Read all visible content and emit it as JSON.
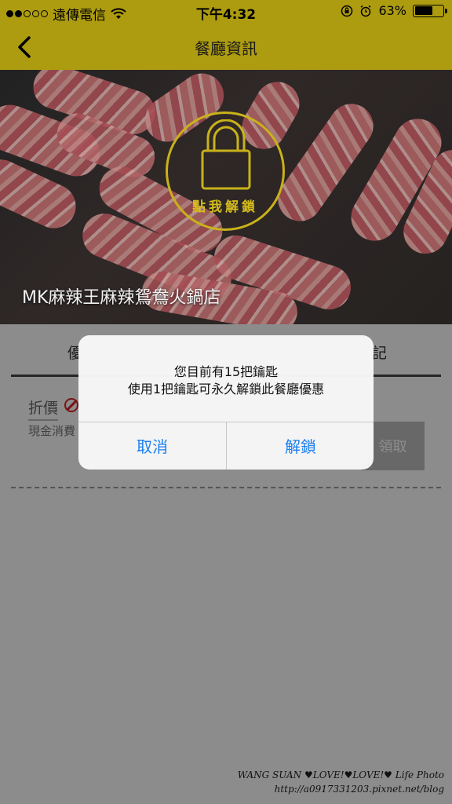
{
  "status_bar": {
    "carrier": "遠傳電信",
    "time": "下午4:32",
    "battery": "63%",
    "battery_level": 0.63,
    "signal_dots_filled": 2,
    "signal_dots_total": 5
  },
  "nav": {
    "title": "餐廳資訊",
    "back_icon": "chevron-left-icon"
  },
  "hero": {
    "unlock_label": "點我解鎖",
    "restaurant_name": "MK麻辣王麻辣鴛鴦火鍋店",
    "lock_icon": "padlock-icon",
    "accent_color": "#c9b21a"
  },
  "tabs": {
    "first_label": "優",
    "last_label": "記"
  },
  "coupon": {
    "type": "折價",
    "description": "現金消費",
    "claim_label": "領取"
  },
  "alert": {
    "line1": "您目前有15把鑰匙",
    "line2": "使用1把鑰匙可永久解鎖此餐廳優惠",
    "cancel_label": "取消",
    "unlock_label": "解鎖",
    "button_color": "#1a7ef0"
  },
  "watermark": {
    "line1": "WANG SUAN ♥LOVE!♥LOVE!♥ Life Photo",
    "line2": "http://a0917331203.pixnet.net/blog"
  },
  "colors": {
    "header_bg": "#ad9c0f"
  }
}
